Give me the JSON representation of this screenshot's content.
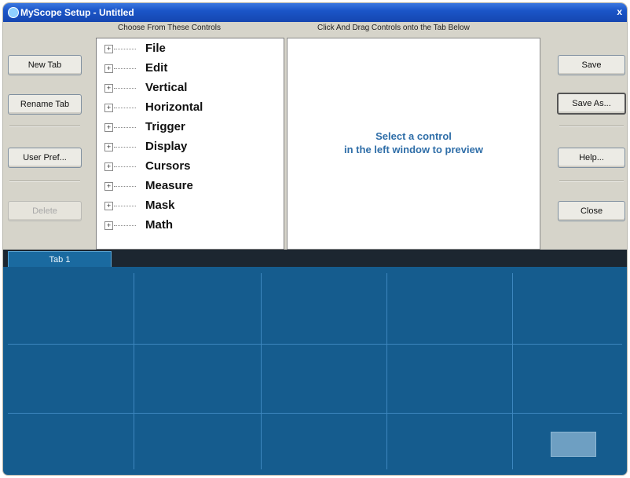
{
  "window": {
    "title": "MyScope Setup - Untitled",
    "close_glyph": "x"
  },
  "headers": {
    "controls": "Choose From These Controls",
    "preview": "Click And Drag Controls onto the Tab Below"
  },
  "left_buttons": {
    "new_tab": "New Tab",
    "rename_tab": "Rename Tab",
    "user_pref": "User Pref...",
    "delete": "Delete"
  },
  "right_buttons": {
    "save": "Save",
    "save_as": "Save As...",
    "help": "Help...",
    "close": "Close"
  },
  "tree_items": [
    "File",
    "Edit",
    "Vertical",
    "Horizontal",
    "Trigger",
    "Display",
    "Cursors",
    "Measure",
    "Mask",
    "Math"
  ],
  "preview": {
    "line1": "Select a control",
    "line2": "in the left window to preview"
  },
  "tabs": [
    {
      "label": "Tab 1"
    }
  ],
  "colors": {
    "tab_area": "#155c8e",
    "preview_text": "#2f6ea8",
    "title_bar": "#1b55c8"
  },
  "icons": {
    "expand": "plus-box-icon",
    "scroll_up": "arrow-up-icon",
    "scroll_down": "arrow-down-icon"
  }
}
